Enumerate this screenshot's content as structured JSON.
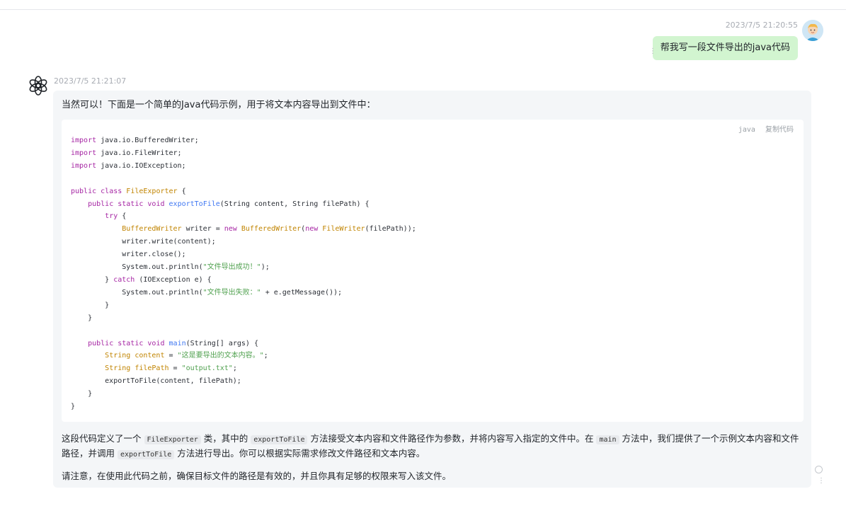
{
  "user_message": {
    "timestamp": "2023/7/5 21:20:55",
    "text": "帮我写一段文件导出的java代码"
  },
  "assistant_message": {
    "timestamp": "2023/7/5 21:21:07",
    "intro": "当然可以！下面是一个简单的Java代码示例，用于将文本内容导出到文件中：",
    "code_language": "java",
    "copy_label": "复制代码",
    "code_lines": [
      "import java.io.BufferedWriter;",
      "import java.io.FileWriter;",
      "import java.io.IOException;",
      "",
      "public class FileExporter {",
      "    public static void exportToFile(String content, String filePath) {",
      "        try {",
      "            BufferedWriter writer = new BufferedWriter(new FileWriter(filePath));",
      "            writer.write(content);",
      "            writer.close();",
      "            System.out.println(\"文件导出成功！\");",
      "        } catch (IOException e) {",
      "            System.out.println(\"文件导出失败：\" + e.getMessage());",
      "        }",
      "    }",
      "",
      "    public static void main(String[] args) {",
      "        String content = \"这是要导出的文本内容。\";",
      "        String filePath = \"output.txt\";",
      "        exportToFile(content, filePath);",
      "    }",
      "}"
    ],
    "para1": {
      "t1": "这段代码定义了一个",
      "c1": "FileExporter",
      "t2": "类，其中的",
      "c2": "exportToFile",
      "t3": "方法接受文本内容和文件路径作为参数，并将内容写入指定的文件中。在",
      "c3": "main",
      "t4": "方法中，我们提供了一个示例文本内容和文件路径，并调用",
      "c4": "exportToFile",
      "t5": "方法进行导出。你可以根据实际需求修改文件路径和文本内容。"
    },
    "para2": "请注意，在使用此代码之前，确保目标文件的路径是有效的，并且你具有足够的权限来写入该文件。"
  },
  "colors": {
    "user_bubble": "#d2f5d0",
    "assistant_panel": "#f4f6f8",
    "keyword": "#a626a4",
    "class": "#c18401",
    "function": "#4078f2",
    "string": "#50a14f"
  },
  "icons": [
    "user-avatar-icon",
    "chatgpt-logo-icon",
    "more-options-icon",
    "regenerate-icon"
  ]
}
